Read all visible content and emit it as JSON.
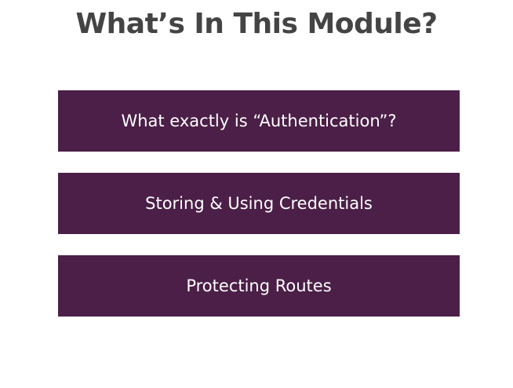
{
  "slide": {
    "title": "What’s In This Module?",
    "items": [
      {
        "label": "What exactly is “Authentication”?"
      },
      {
        "label": "Storing & Using Credentials"
      },
      {
        "label": "Protecting Routes"
      }
    ]
  },
  "colors": {
    "title": "#444444",
    "item_background": "#4b1f47",
    "item_text": "#ffffff",
    "background": "#ffffff"
  }
}
